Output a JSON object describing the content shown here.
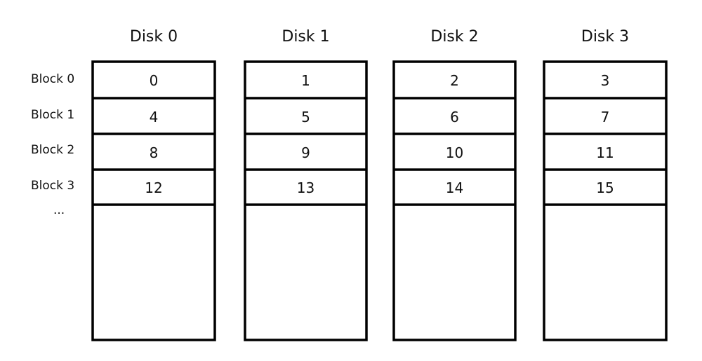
{
  "row_labels": [
    "Block 0",
    "Block 1",
    "Block 2",
    "Block 3",
    "..."
  ],
  "disks": [
    {
      "title": "Disk 0",
      "blocks": [
        "0",
        "4",
        "8",
        "12"
      ]
    },
    {
      "title": "Disk 1",
      "blocks": [
        "1",
        "5",
        "9",
        "13"
      ]
    },
    {
      "title": "Disk 2",
      "blocks": [
        "2",
        "6",
        "10",
        "14"
      ]
    },
    {
      "title": "Disk 3",
      "blocks": [
        "3",
        "7",
        "11",
        "15"
      ]
    }
  ],
  "colors": {
    "stroke": "#000000",
    "background": "#ffffff"
  }
}
